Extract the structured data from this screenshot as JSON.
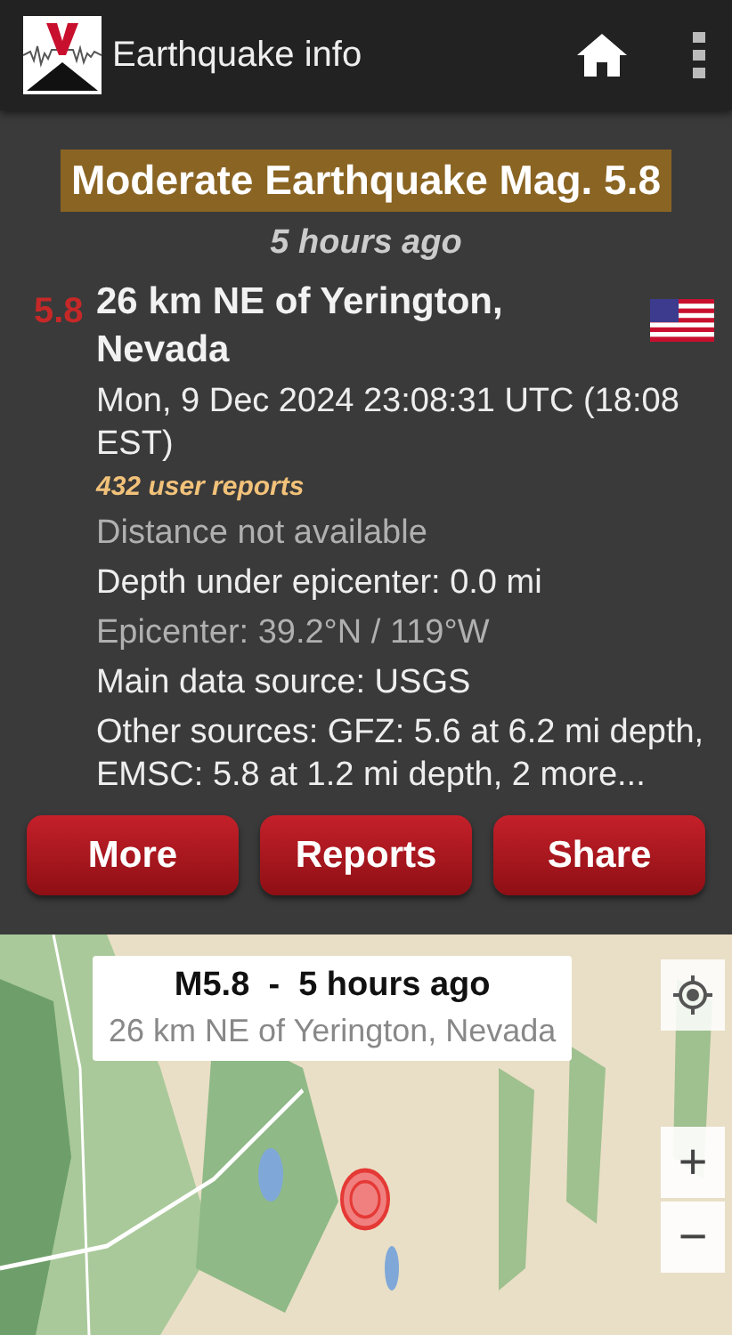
{
  "app_bar": {
    "title": "Earthquake info"
  },
  "headline": "Moderate Earthquake Mag. 5.8",
  "time_ago": "5 hours ago",
  "quake": {
    "magnitude": "5.8",
    "place": "26 km NE of Yerington, Nevada"
  },
  "details": [
    {
      "kind": "normal",
      "text": "Mon, 9 Dec 2024 23:08:31 UTC (18:08 EST)"
    },
    {
      "kind": "reports",
      "text": "432 user reports"
    },
    {
      "kind": "dim",
      "text": "Distance not available"
    },
    {
      "kind": "normal",
      "text": "Depth under epicenter: 0.0 mi"
    },
    {
      "kind": "dim",
      "text": "Epicenter: 39.2°N / 119°W"
    },
    {
      "kind": "normal",
      "text": "Main data source: USGS"
    },
    {
      "kind": "normal",
      "text": "Other sources: GFZ: 5.6 at 6.2 mi depth, EMSC: 5.8 at 1.2 mi depth, 2 more..."
    }
  ],
  "buttons": [
    "More",
    "Reports",
    "Share"
  ],
  "map": {
    "popup_title": "M5.8  -  5 hours ago",
    "popup_subtitle": "26 km NE of Yerington, Nevada",
    "zoom_in": "+",
    "zoom_out": "−"
  }
}
